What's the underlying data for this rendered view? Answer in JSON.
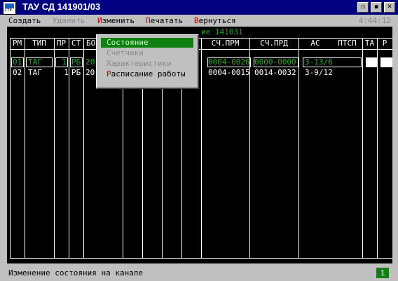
{
  "window": {
    "title": "ТАУ СД 141901/03",
    "icon_label": "СТК",
    "buttons": [
      "▫",
      "▪",
      "✕"
    ]
  },
  "menubar": {
    "items": [
      {
        "label": "Создать",
        "enabled": true
      },
      {
        "label": "Удалить",
        "enabled": false
      },
      {
        "label_pre": "",
        "hotkey": "И",
        "label_post": "зменить",
        "enabled": true
      },
      {
        "label_pre": "",
        "hotkey": "П",
        "label_post": "ечатать",
        "enabled": true
      },
      {
        "label_pre": "",
        "hotkey": "В",
        "label_post": "ернуться",
        "enabled": true
      }
    ],
    "clock": "4:44:12"
  },
  "main": {
    "subtitle": "ие 141031",
    "columns": [
      "РМ",
      "ТИП",
      "ПР",
      "СТ",
      "БО",
      "",
      "",
      "",
      "",
      "",
      "СЧ.ПРМ",
      "СЧ.ПРД",
      "АС",
      "ПТСП",
      "ТА",
      "Р"
    ],
    "rows": [
      {
        "rm": "01",
        "tip": "ТАГ",
        "pr": "1",
        "st": "РБ",
        "bo": "20",
        "sch_prm": "0004-0026",
        "sch_prd": "0000-0000",
        "as": "3-13/6",
        "ta": "",
        "r": ""
      },
      {
        "rm": "02",
        "tip": "ТАГ",
        "pr": "1",
        "st": "РБ",
        "bo": "20",
        "sch_prm": "0004-0015",
        "sch_prd": "0014-0032",
        "as": "3-9/12",
        "ta": "",
        "r": ""
      }
    ]
  },
  "dropdown": {
    "items": [
      {
        "label": "Состояние",
        "state": "selected"
      },
      {
        "label": "Счетчики",
        "state": "disabled"
      },
      {
        "label": "Характеристики",
        "state": "disabled"
      },
      {
        "hotkey": "Р",
        "label_post": "асписание работы",
        "state": "enabled"
      }
    ]
  },
  "statusbar": {
    "text": "Изменение состояния на канале",
    "badge": "1"
  },
  "colors": {
    "title_bg": "#000080",
    "highlight_green": "#108010",
    "text_green": "#20b020",
    "hotkey_red": "#b00000"
  }
}
